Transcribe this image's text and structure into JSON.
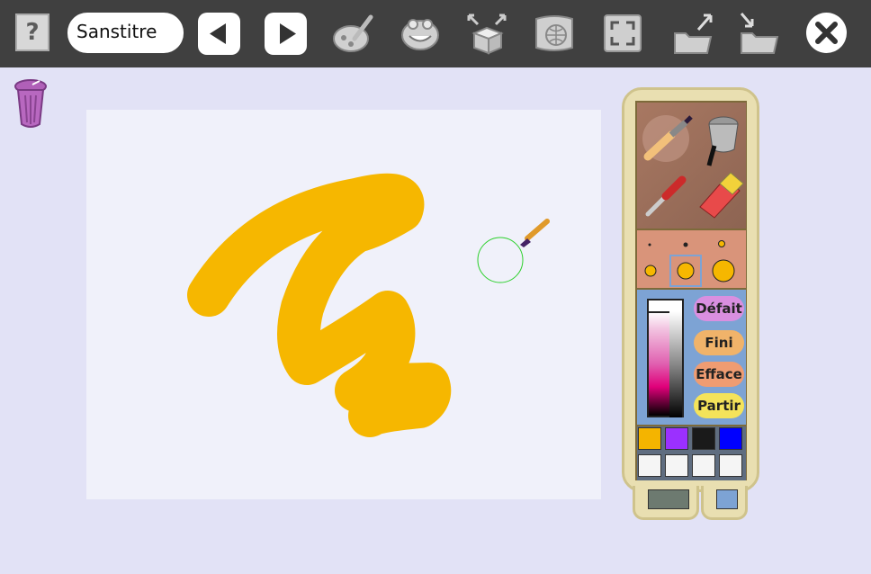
{
  "toolbar": {
    "help_label": "?",
    "file_name": "Sanstitre",
    "buttons": [
      {
        "name": "back-button",
        "icon": "triangle-left-icon"
      },
      {
        "name": "forward-button",
        "icon": "triangle-right-icon"
      },
      {
        "name": "paint-button",
        "icon": "palette-brush-icon"
      },
      {
        "name": "stamp-button",
        "icon": "smiley-icon"
      },
      {
        "name": "activities-button",
        "icon": "box-arrows-icon"
      },
      {
        "name": "web-button",
        "icon": "globe-icon"
      },
      {
        "name": "fullscreen-button",
        "icon": "fullscreen-icon"
      },
      {
        "name": "save-button",
        "icon": "folder-up-icon"
      },
      {
        "name": "open-button",
        "icon": "folder-down-icon"
      },
      {
        "name": "quit-button",
        "icon": "close-icon"
      }
    ]
  },
  "panel": {
    "tools": [
      "brush-icon",
      "paint-bucket-icon",
      "dropper-icon",
      "eraser-icon"
    ],
    "sizes": [
      "small",
      "small",
      "small",
      "medium",
      "medium-selected",
      "large"
    ],
    "actions": [
      {
        "label": "Défait",
        "color": "#d98fe0"
      },
      {
        "label": "Fini",
        "color": "#f0b36a"
      },
      {
        "label": "Efface",
        "color": "#ef9c72"
      },
      {
        "label": "Partir",
        "color": "#f4e35a"
      }
    ],
    "palette": [
      "#f4b400",
      "#9b30ff",
      "#1a1a1a",
      "#0000ff",
      "#f5f5f5",
      "#f5f5f5",
      "#f5f5f5",
      "#f5f5f5"
    ],
    "tabs": [
      "tools-tab",
      "brush-tab"
    ]
  },
  "colors": {
    "stroke": "#f6b700",
    "cursor_circle": "#2bd02b"
  }
}
